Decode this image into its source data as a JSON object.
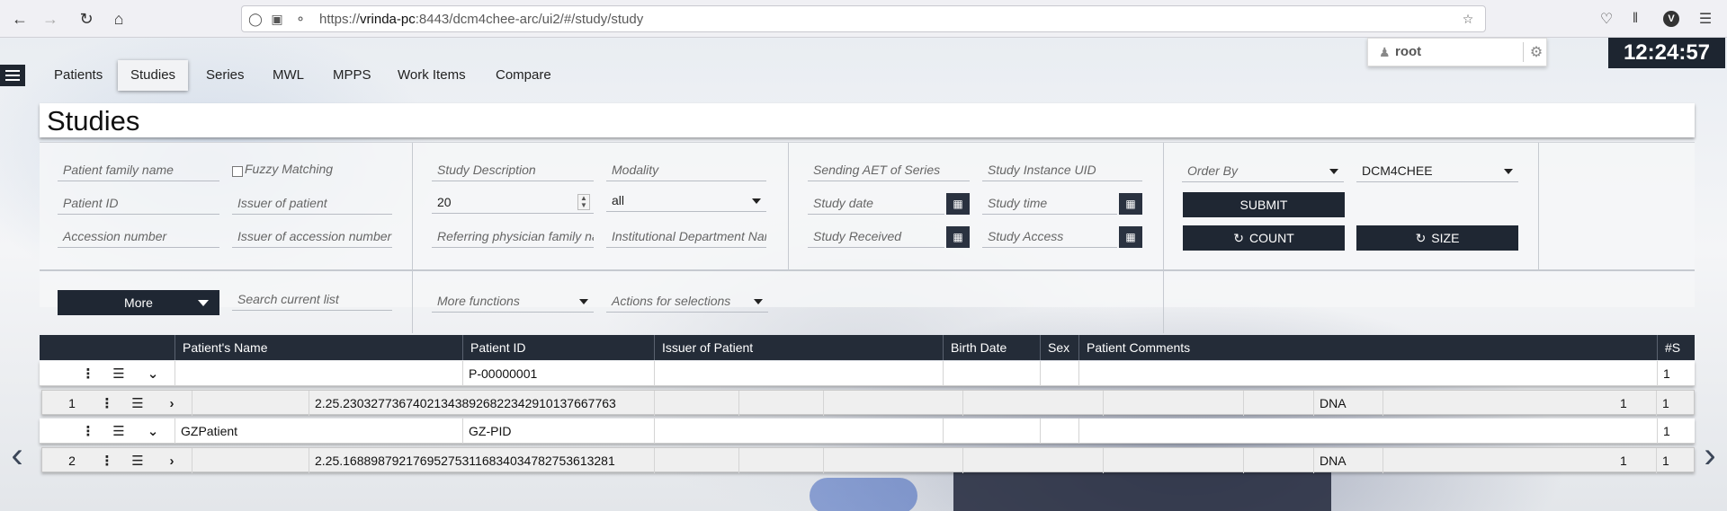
{
  "browser": {
    "url_prefix": "https://",
    "url_host": "vrinda-pc",
    "url_rest": ":8443/dcm4chee-arc/ui2/#/study/study",
    "profile_letter": "V"
  },
  "header": {
    "user": "root",
    "clock": "12:24:57"
  },
  "tabs": [
    "Patients",
    "Studies",
    "Series",
    "MWL",
    "MPPS",
    "Work Items",
    "Compare"
  ],
  "page_title": "Studies",
  "filters": {
    "patient_family_name": "Patient family name",
    "fuzzy_matching": "Fuzzy Matching",
    "patient_id": "Patient ID",
    "issuer_of_patient": "Issuer of patient",
    "accession_number": "Accession number",
    "issuer_of_accession": "Issuer of accession number",
    "study_description": "Study Description",
    "modality": "Modality",
    "limit": "20",
    "all": "all",
    "referring_physician": "Referring physician family name",
    "institutional_department": "Institutional Department Name",
    "sending_aet": "Sending AET of Series",
    "study_instance_uid": "Study Instance UID",
    "study_date": "Study date",
    "study_time": "Study time",
    "study_received": "Study Received",
    "study_access": "Study Access",
    "order_by": "Order By",
    "aet": "DCM4CHEE",
    "submit": "SUBMIT",
    "count": "COUNT",
    "size": "SIZE",
    "more": "More",
    "search_current_list": "Search current list",
    "more_functions": "More functions",
    "actions_for_selections": "Actions for selections"
  },
  "table": {
    "headers": [
      "Patient's Name",
      "Patient ID",
      "Issuer of Patient",
      "Birth Date",
      "Sex",
      "Patient Comments",
      "#S"
    ],
    "patients": [
      {
        "name": "",
        "id": "P-00000001",
        "num_studies": "1",
        "study": {
          "index": "1",
          "uid": "2.25.230327736740213438926822342910137667763",
          "modality": "DNA",
          "series": "1",
          "instances": "1"
        }
      },
      {
        "name": "GZPatient",
        "id": "GZ-PID",
        "num_studies": "1",
        "study": {
          "index": "2",
          "uid": "2.25.168898792176952753116834034782753613281",
          "modality": "DNA",
          "series": "1",
          "instances": "1"
        }
      }
    ]
  }
}
